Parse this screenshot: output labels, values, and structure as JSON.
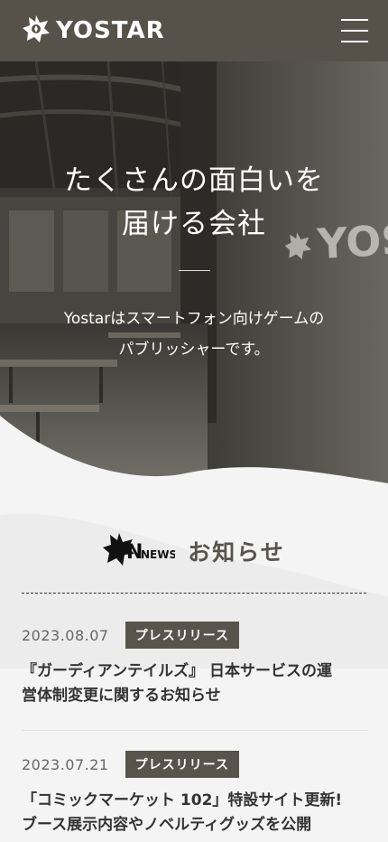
{
  "header": {
    "logo_text": "YOSTAR",
    "menu_icon": "hamburger-menu-icon",
    "background": "#56524a"
  },
  "hero": {
    "title": "たくさんの面白いを\n届ける会社",
    "description": "Yostarはスマートフォン向けゲームの\nパブリッシャーです。",
    "wall_sign": "YOST"
  },
  "news": {
    "logo_text": "NEWS",
    "title": "お知らせ",
    "items": [
      {
        "date": "2023.08.07",
        "tag": "プレスリリース",
        "headline": "『ガーディアンテイルズ』 日本サービスの運\n営体制変更に関するお知らせ"
      },
      {
        "date": "2023.07.21",
        "tag": "プレスリリース",
        "headline": "「コミックマーケット 102」特設サイト更新!\nブース展示内容やノベルティグッズを公開"
      }
    ],
    "tag_color": "#58544c"
  }
}
